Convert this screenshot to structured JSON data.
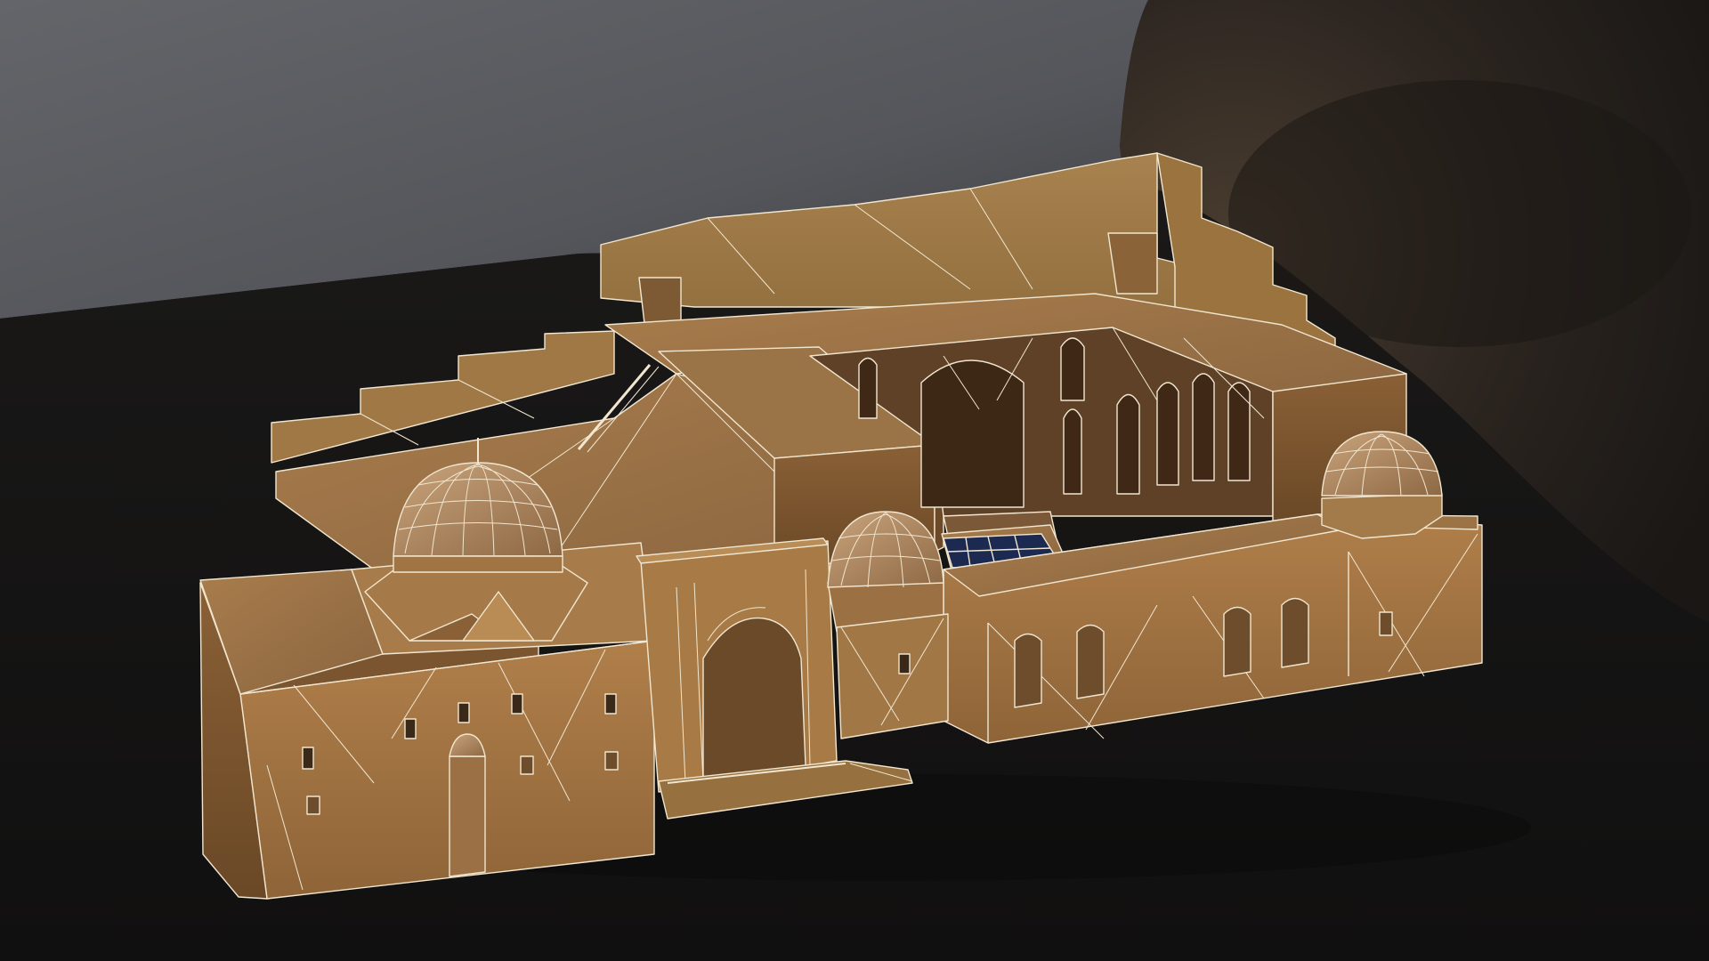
{
  "scene": {
    "subject": "3d-render",
    "colors": {
      "backdrop_wall": "#5a5b60",
      "backdrop_wall_right": "#2e2a26",
      "floor": "#171615",
      "roof": "#9c7447",
      "wall_lit": "#a87a48",
      "wall_shade": "#7c5733",
      "dome": "#b08860",
      "wire": "#f4ecd8",
      "glass": "#1c2a52"
    }
  }
}
